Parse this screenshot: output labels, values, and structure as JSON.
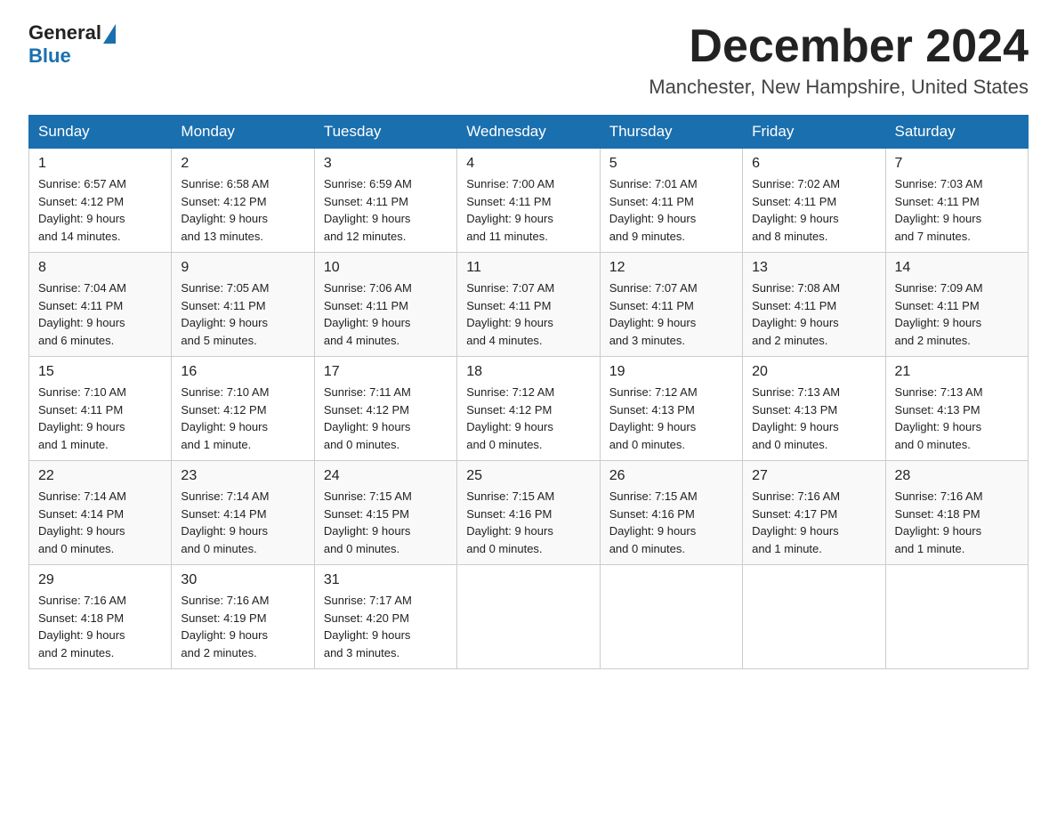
{
  "header": {
    "logo_general": "General",
    "logo_blue": "Blue",
    "month_title": "December 2024",
    "location": "Manchester, New Hampshire, United States"
  },
  "days_of_week": [
    "Sunday",
    "Monday",
    "Tuesday",
    "Wednesday",
    "Thursday",
    "Friday",
    "Saturday"
  ],
  "weeks": [
    [
      {
        "day": "1",
        "sunrise": "6:57 AM",
        "sunset": "4:12 PM",
        "daylight": "9 hours and 14 minutes."
      },
      {
        "day": "2",
        "sunrise": "6:58 AM",
        "sunset": "4:12 PM",
        "daylight": "9 hours and 13 minutes."
      },
      {
        "day": "3",
        "sunrise": "6:59 AM",
        "sunset": "4:11 PM",
        "daylight": "9 hours and 12 minutes."
      },
      {
        "day": "4",
        "sunrise": "7:00 AM",
        "sunset": "4:11 PM",
        "daylight": "9 hours and 11 minutes."
      },
      {
        "day": "5",
        "sunrise": "7:01 AM",
        "sunset": "4:11 PM",
        "daylight": "9 hours and 9 minutes."
      },
      {
        "day": "6",
        "sunrise": "7:02 AM",
        "sunset": "4:11 PM",
        "daylight": "9 hours and 8 minutes."
      },
      {
        "day": "7",
        "sunrise": "7:03 AM",
        "sunset": "4:11 PM",
        "daylight": "9 hours and 7 minutes."
      }
    ],
    [
      {
        "day": "8",
        "sunrise": "7:04 AM",
        "sunset": "4:11 PM",
        "daylight": "9 hours and 6 minutes."
      },
      {
        "day": "9",
        "sunrise": "7:05 AM",
        "sunset": "4:11 PM",
        "daylight": "9 hours and 5 minutes."
      },
      {
        "day": "10",
        "sunrise": "7:06 AM",
        "sunset": "4:11 PM",
        "daylight": "9 hours and 4 minutes."
      },
      {
        "day": "11",
        "sunrise": "7:07 AM",
        "sunset": "4:11 PM",
        "daylight": "9 hours and 4 minutes."
      },
      {
        "day": "12",
        "sunrise": "7:07 AM",
        "sunset": "4:11 PM",
        "daylight": "9 hours and 3 minutes."
      },
      {
        "day": "13",
        "sunrise": "7:08 AM",
        "sunset": "4:11 PM",
        "daylight": "9 hours and 2 minutes."
      },
      {
        "day": "14",
        "sunrise": "7:09 AM",
        "sunset": "4:11 PM",
        "daylight": "9 hours and 2 minutes."
      }
    ],
    [
      {
        "day": "15",
        "sunrise": "7:10 AM",
        "sunset": "4:11 PM",
        "daylight": "9 hours and 1 minute."
      },
      {
        "day": "16",
        "sunrise": "7:10 AM",
        "sunset": "4:12 PM",
        "daylight": "9 hours and 1 minute."
      },
      {
        "day": "17",
        "sunrise": "7:11 AM",
        "sunset": "4:12 PM",
        "daylight": "9 hours and 0 minutes."
      },
      {
        "day": "18",
        "sunrise": "7:12 AM",
        "sunset": "4:12 PM",
        "daylight": "9 hours and 0 minutes."
      },
      {
        "day": "19",
        "sunrise": "7:12 AM",
        "sunset": "4:13 PM",
        "daylight": "9 hours and 0 minutes."
      },
      {
        "day": "20",
        "sunrise": "7:13 AM",
        "sunset": "4:13 PM",
        "daylight": "9 hours and 0 minutes."
      },
      {
        "day": "21",
        "sunrise": "7:13 AM",
        "sunset": "4:13 PM",
        "daylight": "9 hours and 0 minutes."
      }
    ],
    [
      {
        "day": "22",
        "sunrise": "7:14 AM",
        "sunset": "4:14 PM",
        "daylight": "9 hours and 0 minutes."
      },
      {
        "day": "23",
        "sunrise": "7:14 AM",
        "sunset": "4:14 PM",
        "daylight": "9 hours and 0 minutes."
      },
      {
        "day": "24",
        "sunrise": "7:15 AM",
        "sunset": "4:15 PM",
        "daylight": "9 hours and 0 minutes."
      },
      {
        "day": "25",
        "sunrise": "7:15 AM",
        "sunset": "4:16 PM",
        "daylight": "9 hours and 0 minutes."
      },
      {
        "day": "26",
        "sunrise": "7:15 AM",
        "sunset": "4:16 PM",
        "daylight": "9 hours and 0 minutes."
      },
      {
        "day": "27",
        "sunrise": "7:16 AM",
        "sunset": "4:17 PM",
        "daylight": "9 hours and 1 minute."
      },
      {
        "day": "28",
        "sunrise": "7:16 AM",
        "sunset": "4:18 PM",
        "daylight": "9 hours and 1 minute."
      }
    ],
    [
      {
        "day": "29",
        "sunrise": "7:16 AM",
        "sunset": "4:18 PM",
        "daylight": "9 hours and 2 minutes."
      },
      {
        "day": "30",
        "sunrise": "7:16 AM",
        "sunset": "4:19 PM",
        "daylight": "9 hours and 2 minutes."
      },
      {
        "day": "31",
        "sunrise": "7:17 AM",
        "sunset": "4:20 PM",
        "daylight": "9 hours and 3 minutes."
      },
      null,
      null,
      null,
      null
    ]
  ],
  "labels": {
    "sunrise": "Sunrise:",
    "sunset": "Sunset:",
    "daylight": "Daylight:"
  }
}
